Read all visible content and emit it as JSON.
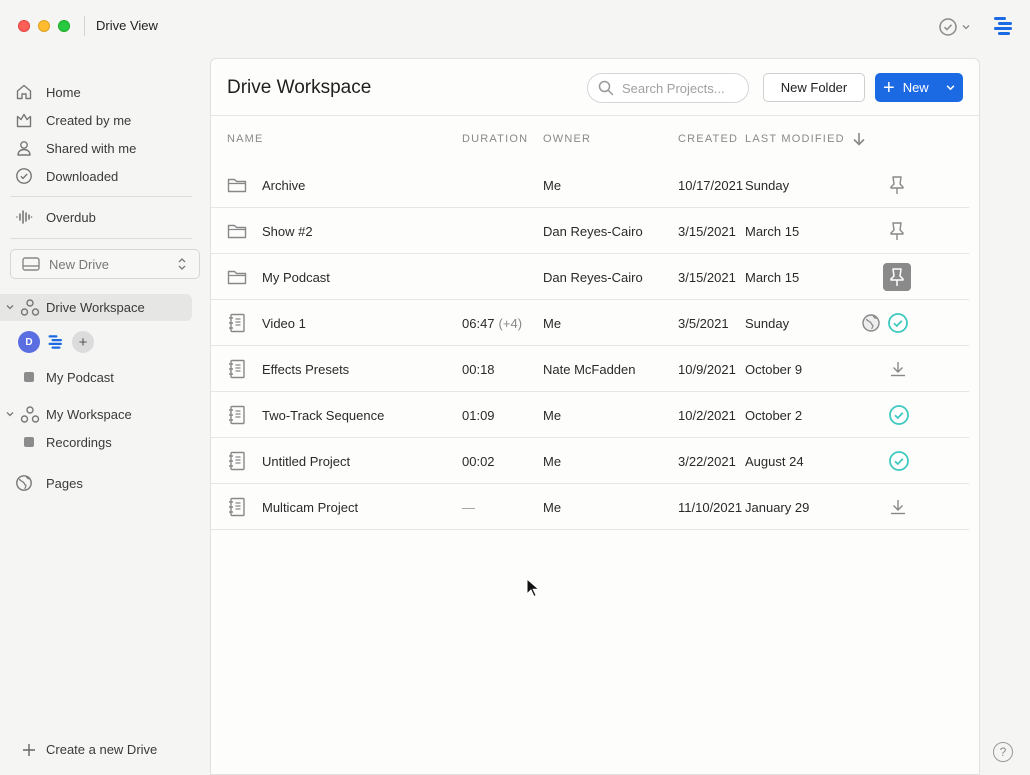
{
  "window": {
    "title": "Drive View"
  },
  "sidebar": {
    "nav": [
      {
        "label": "Home",
        "icon": "home-icon"
      },
      {
        "label": "Created by me",
        "icon": "crown-icon"
      },
      {
        "label": "Shared with me",
        "icon": "person-icon"
      },
      {
        "label": "Downloaded",
        "icon": "check-circle-icon"
      }
    ],
    "overdub": {
      "label": "Overdub",
      "icon": "waveform-icon"
    },
    "new_drive": {
      "label": "New Drive"
    },
    "workspaces": [
      {
        "label": "Drive Workspace",
        "active": true,
        "member_initial": "D",
        "children": [
          {
            "label": "My Podcast"
          }
        ]
      },
      {
        "label": "My Workspace",
        "active": false,
        "children": [
          {
            "label": "Recordings"
          }
        ]
      }
    ],
    "pages": {
      "label": "Pages"
    },
    "create_drive": {
      "label": "Create a new Drive"
    }
  },
  "main": {
    "title": "Drive Workspace",
    "search_placeholder": "Search Projects...",
    "new_folder_label": "New Folder",
    "new_label": "New",
    "columns": {
      "name": "NAME",
      "duration": "DURATION",
      "owner": "OWNER",
      "created": "CREATED",
      "modified": "LAST MODIFIED"
    },
    "rows": [
      {
        "type": "folder",
        "name": "Archive",
        "duration": "",
        "extra": "",
        "owner": "Me",
        "created": "10/17/2021",
        "modified": "Sunday",
        "action": "pin"
      },
      {
        "type": "folder",
        "name": "Show #2",
        "duration": "",
        "extra": "",
        "owner": "Dan Reyes-Cairo",
        "created": "3/15/2021",
        "modified": "March 15",
        "action": "pin"
      },
      {
        "type": "folder",
        "name": "My Podcast",
        "duration": "",
        "extra": "",
        "owner": "Dan Reyes-Cairo",
        "created": "3/15/2021",
        "modified": "March 15",
        "action": "pin-active"
      },
      {
        "type": "project",
        "name": "Video 1",
        "duration": "06:47",
        "extra": "(+4)",
        "owner": "Me",
        "created": "3/5/2021",
        "modified": "Sunday",
        "action": "published-synced"
      },
      {
        "type": "project",
        "name": "Effects Presets",
        "duration": "00:18",
        "extra": "",
        "owner": "Nate McFadden",
        "created": "10/9/2021",
        "modified": "October 9",
        "action": "download"
      },
      {
        "type": "project",
        "name": "Two-Track Sequence",
        "duration": "01:09",
        "extra": "",
        "owner": "Me",
        "created": "10/2/2021",
        "modified": "October 2",
        "action": "synced"
      },
      {
        "type": "project",
        "name": "Untitled Project",
        "duration": "00:02",
        "extra": "",
        "owner": "Me",
        "created": "3/22/2021",
        "modified": "August 24",
        "action": "synced"
      },
      {
        "type": "project",
        "name": "Multicam Project",
        "duration": "—",
        "extra": "",
        "owner": "Me",
        "created": "11/10/2021",
        "modified": "January 29",
        "action": "download"
      }
    ]
  },
  "help": {
    "label": "?"
  },
  "colors": {
    "accent": "#1b6ae4",
    "synced": "#3fc9c0",
    "avatar": "#5b6ee1"
  }
}
